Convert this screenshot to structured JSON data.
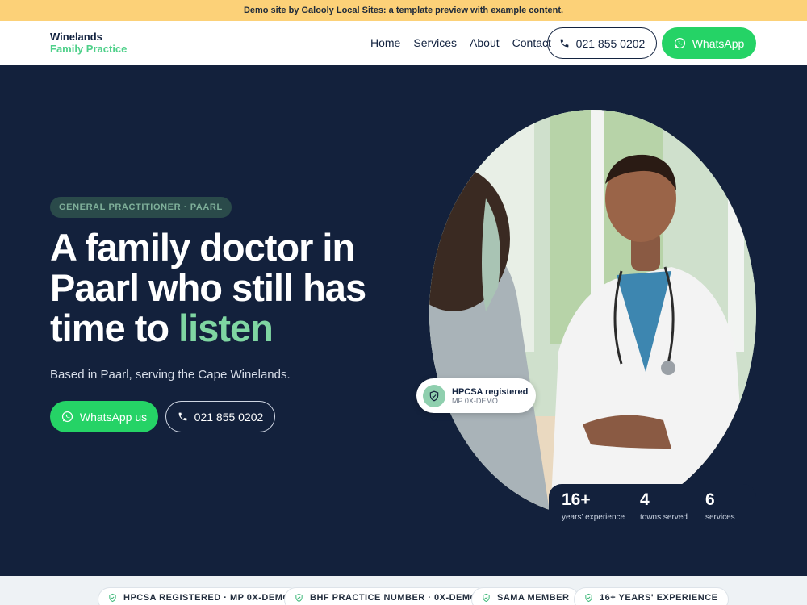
{
  "banner": {
    "text": "Demo site by Galooly Local Sites: a template preview with example content."
  },
  "brand": {
    "line1": "Winelands",
    "line2": "Family Practice",
    "accent": "#4fd08a",
    "navy": "#13213c"
  },
  "nav": {
    "links": [
      "Home",
      "Services",
      "About",
      "Contact"
    ],
    "phone": "021 855 0202",
    "whatsapp": "WhatsApp"
  },
  "hero": {
    "eyebrow": "GENERAL PRACTITIONER · PAARL",
    "headline_part1": "A family doctor in Paarl who still has time to ",
    "headline_accent": "listen",
    "subtitle": "Based in Paarl, serving the Cape Winelands.",
    "cta_whatsapp": "WhatsApp us",
    "cta_phone": "021 855 0202"
  },
  "credential": {
    "title": "HPCSA registered",
    "subtitle": "MP 0X-DEMO",
    "icon": "shield-check-icon"
  },
  "stats": [
    {
      "value": "16+",
      "label": "years' experience"
    },
    {
      "value": "4",
      "label": "towns served"
    },
    {
      "value": "6",
      "label": "services"
    }
  ],
  "trust_badges": [
    "HPCSA REGISTERED · MP 0X-DEMO",
    "BHF PRACTICE NUMBER · 0X-DEMO",
    "SAMA MEMBER",
    "16+ YEARS' EXPERIENCE"
  ]
}
